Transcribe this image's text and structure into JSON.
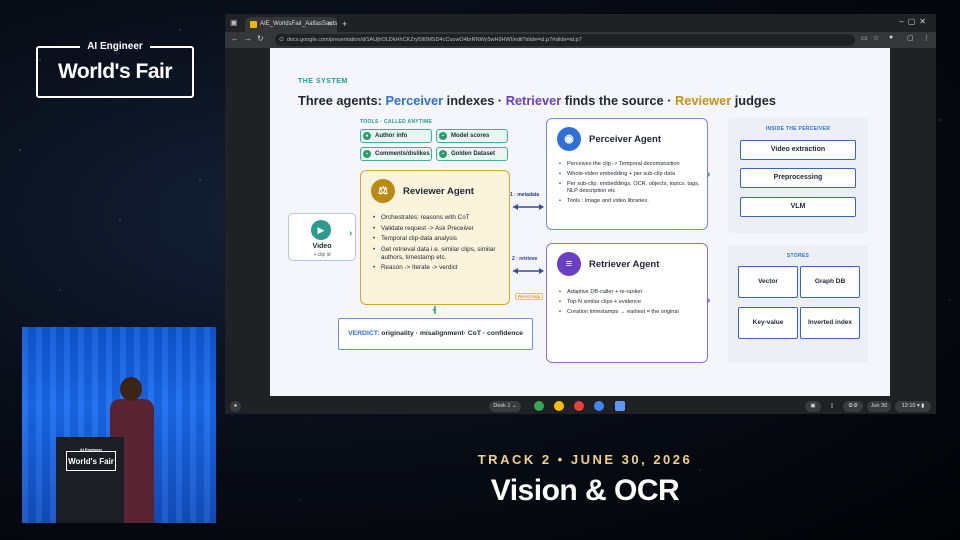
{
  "event": {
    "small": "AI Engineer",
    "big": "World's Fair"
  },
  "podium": {
    "small": "AI Engineer",
    "big": "World's Fair"
  },
  "track": "TRACK 2 • JUNE 30, 2026",
  "session": "Vision & OCR",
  "browser": {
    "tab_title": "AIE_WorldsFair_AatlasSautsen",
    "url": "docs.google.com/presentation/d/1AUjhOLDkHhCKZry590MSD4cCuuwO4brRNWy5wH9HWI/edit?slide=id.p7#slide=id.p7"
  },
  "slide": {
    "kicker": "THE SYSTEM",
    "headline": {
      "p1": "Three agents: ",
      "perceiver": "Perceiver",
      "p2": " indexes · ",
      "retriever": "Retriever",
      "p3": " finds the source · ",
      "reviewer": "Reviewer",
      "p4": " judges"
    },
    "tools_label": "TOOLS · CALLED ANYTIME",
    "tools": [
      "Author info",
      "Model scores",
      "Comments/dislikes",
      "Golden Dataset"
    ],
    "video": {
      "label": "Video",
      "sub": "+ clip id"
    },
    "reviewer": {
      "title": "Reviewer Agent",
      "bullets": [
        "Orchestrates; reasons with CoT",
        "Validate request -> Ask Preceiver",
        "Temporal clip-data analysis",
        "Get retrieval data i.e. similar clips, similar authors, timestamp etc.",
        "Reason -> Iterate -> verdict"
      ]
    },
    "perceiver": {
      "title": "Perceiver Agent",
      "bullets": [
        "Perceives the clip -> Temporal decomposition",
        "Whole-video embedding + per sub-clip data",
        "Per sub-clip: embeddings, OCR, objects, topics, tags, NLP description etc",
        "Tools : Image and video libraries."
      ]
    },
    "retriever": {
      "title": "Retriever Agent",
      "bullets": [
        "Adaptive DB-caller + re-ranker",
        "Top-N similar clips + evidence",
        "Creation timestamps → earliest = the original"
      ]
    },
    "links": {
      "metadata": "1 · metadata",
      "retrieve": "2 · retrieve",
      "react": "ReAct loop"
    },
    "verdict": {
      "key": "VERDICT:",
      "text": " originality · misalignment· CoT · confidence"
    },
    "inside": {
      "title": "INSIDE THE PERCEIVER",
      "steps": [
        "Video extraction",
        "Preprocessing",
        "VLM"
      ]
    },
    "stores": {
      "title": "STORES",
      "items": [
        "Vector",
        "Graph DB",
        "Key-value",
        "Inverted index"
      ]
    }
  },
  "shelf": {
    "desk": "Desk 1",
    "date": "Jun 30",
    "time": "12:10"
  },
  "colors": {
    "teal": "#1f9b8f",
    "perceiver_blue": "#2f6fd6",
    "retriever_purple": "#6a3fc4",
    "reviewer_gold": "#c69410",
    "track_gold": "#f1d184"
  }
}
